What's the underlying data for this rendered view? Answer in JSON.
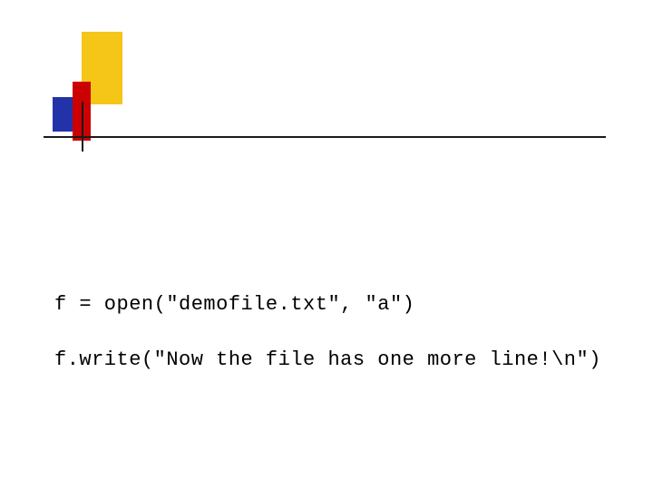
{
  "code": {
    "line1": "f = open(\"demofile.txt\", \"a\")",
    "line2": "f.write(\"Now the file has one more line!\\n\")"
  }
}
